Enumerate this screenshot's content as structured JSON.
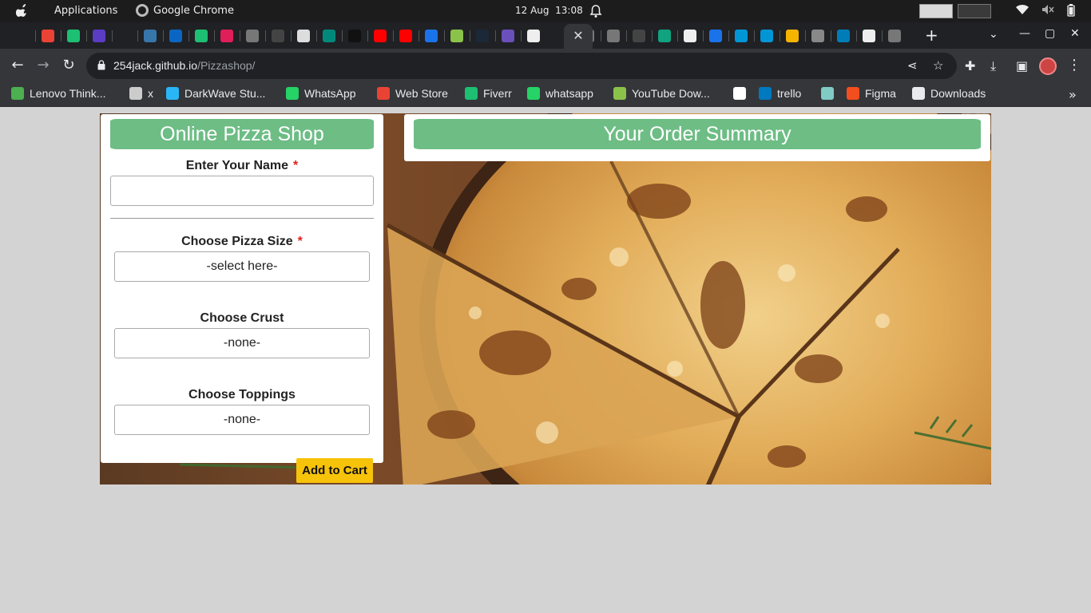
{
  "os_bar": {
    "apps_label": "Applications",
    "active_app": "Google Chrome",
    "date": "12 Aug",
    "time": "13:08"
  },
  "browser": {
    "tabs": [
      {
        "icon": "alx-icon",
        "color": "#202124"
      },
      {
        "icon": "gmail-icon",
        "color": "#ea4335"
      },
      {
        "icon": "fiverr-icon",
        "color": "#1dbf73"
      },
      {
        "icon": "u-icon",
        "color": "#5b3cc4"
      },
      {
        "icon": "alx-icon",
        "color": "#202124"
      },
      {
        "icon": "python-icon",
        "color": "#3776ab"
      },
      {
        "icon": "linkedin-icon",
        "color": "#0a66c2"
      },
      {
        "icon": "fiverr-icon",
        "color": "#1dbf73"
      },
      {
        "icon": "slack-icon",
        "color": "#e01e5a"
      },
      {
        "icon": "globe-icon",
        "color": "#777777"
      },
      {
        "icon": "github-icon",
        "color": "#444444"
      },
      {
        "icon": "doc-icon",
        "color": "#dddddd"
      },
      {
        "icon": "meet-icon",
        "color": "#00897b"
      },
      {
        "icon": "p-icon",
        "color": "#111111"
      },
      {
        "icon": "youtube-icon",
        "color": "#ff0000"
      },
      {
        "icon": "youtube-icon",
        "color": "#ff0000"
      },
      {
        "icon": "check-icon",
        "color": "#1a73e8"
      },
      {
        "icon": "check-circle-icon",
        "color": "#8bc34a"
      },
      {
        "icon": "steam-icon",
        "color": "#1b2838"
      },
      {
        "icon": "az-icon",
        "color": "#6b4fbb"
      },
      {
        "icon": "google-icon",
        "color": "#eeeeee"
      },
      {
        "icon": "globe-icon",
        "color": "#777777"
      },
      {
        "icon": "globe-icon",
        "color": "#777777"
      },
      {
        "icon": "github-icon",
        "color": "#444444"
      },
      {
        "icon": "chatgpt-icon",
        "color": "#10a37f"
      },
      {
        "icon": "google-icon",
        "color": "#eeeeee"
      },
      {
        "icon": "bracket-icon",
        "color": "#1a73e8"
      },
      {
        "icon": "hp-icon",
        "color": "#0096d6"
      },
      {
        "icon": "hp-icon",
        "color": "#0096d6"
      },
      {
        "icon": "dots-icon",
        "color": "#f4b400"
      },
      {
        "icon": "shield-icon",
        "color": "#888888"
      },
      {
        "icon": "dell-icon",
        "color": "#007db8"
      },
      {
        "icon": "google-icon",
        "color": "#eeeeee"
      },
      {
        "icon": "globe-icon",
        "color": "#777777"
      }
    ],
    "url_host": "254jack.github.io",
    "url_path": "/Pizzashop/"
  },
  "bookmarks": [
    {
      "label": "Lenovo Think...",
      "color": "#4caf50"
    },
    {
      "label": "x",
      "color": "#cccccc"
    },
    {
      "label": "DarkWave Stu...",
      "color": "#29b6f6"
    },
    {
      "label": "WhatsApp",
      "color": "#25d366"
    },
    {
      "label": "Web Store",
      "color": "#ea4335"
    },
    {
      "label": "Fiverr",
      "color": "#1dbf73"
    },
    {
      "label": "whatsapp",
      "color": "#25d366"
    },
    {
      "label": "YouTube Dow...",
      "color": "#8bc34a"
    },
    {
      "label": "",
      "color": "#ffffff"
    },
    {
      "label": "trello",
      "color": "#0079bf"
    },
    {
      "label": "",
      "color": "#80cbc4"
    },
    {
      "label": "Figma",
      "color": "#f24e1e"
    },
    {
      "label": "Downloads",
      "color": "#e8eaed"
    }
  ],
  "page": {
    "shop_title": "Online Pizza Shop",
    "name_label": "Enter Your Name",
    "size_label": "Choose Pizza Size",
    "size_value": "-select here-",
    "crust_label": "Choose Crust",
    "crust_value": "-none-",
    "toppings_label": "Choose Toppings",
    "toppings_value": "-none-",
    "required_mark": "*",
    "add_to_cart": "Add to Cart",
    "summary_title": "Your Order Summary",
    "accent_color": "#6dbd85",
    "button_color": "#f7c30a"
  }
}
